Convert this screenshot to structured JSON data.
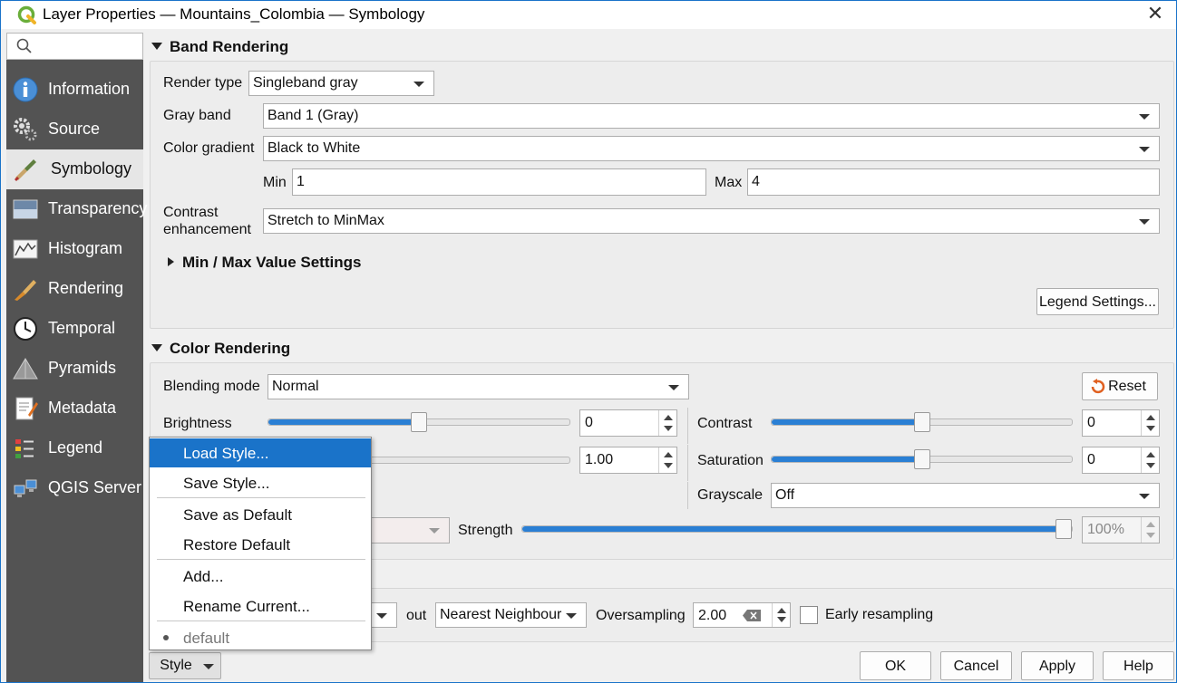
{
  "window": {
    "title": "Layer Properties — Mountains_Colombia — Symbology",
    "close_glyph": "✕"
  },
  "sidebar": {
    "search_placeholder": "",
    "items": [
      {
        "label": "Information",
        "icon": "information-icon"
      },
      {
        "label": "Source",
        "icon": "source-icon"
      },
      {
        "label": "Symbology",
        "icon": "symbology-icon",
        "active": true
      },
      {
        "label": "Transparency",
        "icon": "transparency-icon"
      },
      {
        "label": "Histogram",
        "icon": "histogram-icon"
      },
      {
        "label": "Rendering",
        "icon": "rendering-icon"
      },
      {
        "label": "Temporal",
        "icon": "temporal-icon"
      },
      {
        "label": "Pyramids",
        "icon": "pyramids-icon"
      },
      {
        "label": "Metadata",
        "icon": "metadata-icon"
      },
      {
        "label": "Legend",
        "icon": "legend-icon"
      },
      {
        "label": "QGIS Server",
        "icon": "qgis-server-icon"
      }
    ]
  },
  "band_rendering": {
    "header": "Band Rendering",
    "render_type_label": "Render type",
    "render_type_value": "Singleband gray",
    "gray_band_label": "Gray band",
    "gray_band_value": "Band 1 (Gray)",
    "color_gradient_label": "Color gradient",
    "color_gradient_value": "Black to White",
    "min_label": "Min",
    "min_value": "1",
    "max_label": "Max",
    "max_value": "4",
    "contrast_label_line1": "Contrast",
    "contrast_label_line2": "enhancement",
    "contrast_value": "Stretch to MinMax",
    "minmax_settings_label": "Min / Max Value Settings",
    "legend_settings_button": "Legend Settings..."
  },
  "color_rendering": {
    "header": "Color Rendering",
    "blending_mode_label": "Blending mode",
    "blending_mode_value": "Normal",
    "reset_button": "Reset",
    "brightness_label": "Brightness",
    "brightness_value": "0",
    "brightness_level": 0.5,
    "contrast_label": "Contrast",
    "contrast_value": "0",
    "contrast_level": 0.5,
    "gamma_value": "1.00",
    "saturation_label": "Saturation",
    "saturation_value": "0",
    "saturation_level": 0.5,
    "grayscale_label": "Grayscale",
    "grayscale_value": "Off",
    "strength_label": "Strength",
    "strength_value": "100%",
    "strength_level": 1.0
  },
  "resampling": {
    "out_label": "out",
    "out_value": "Nearest Neighbour",
    "oversampling_label": "Oversampling",
    "oversampling_value": "2.00",
    "early_resampling_label": "Early resampling",
    "early_resampling_checked": false
  },
  "style_menu": {
    "items": [
      {
        "label": "Load Style...",
        "highlighted": true
      },
      {
        "label": "Save Style..."
      },
      {
        "label": "Save as Default"
      },
      {
        "label": "Restore Default"
      },
      {
        "label": "Add..."
      },
      {
        "label": "Rename Current..."
      },
      {
        "label": "default",
        "disabled": true
      }
    ]
  },
  "footer": {
    "style_button": "Style",
    "ok_button": "OK",
    "cancel_button": "Cancel",
    "apply_button": "Apply",
    "help_button": "Help"
  },
  "colors": {
    "accent": "#1a73c9",
    "sidebar_bg": "#535353",
    "slider_fill": "#2a7fd4"
  }
}
